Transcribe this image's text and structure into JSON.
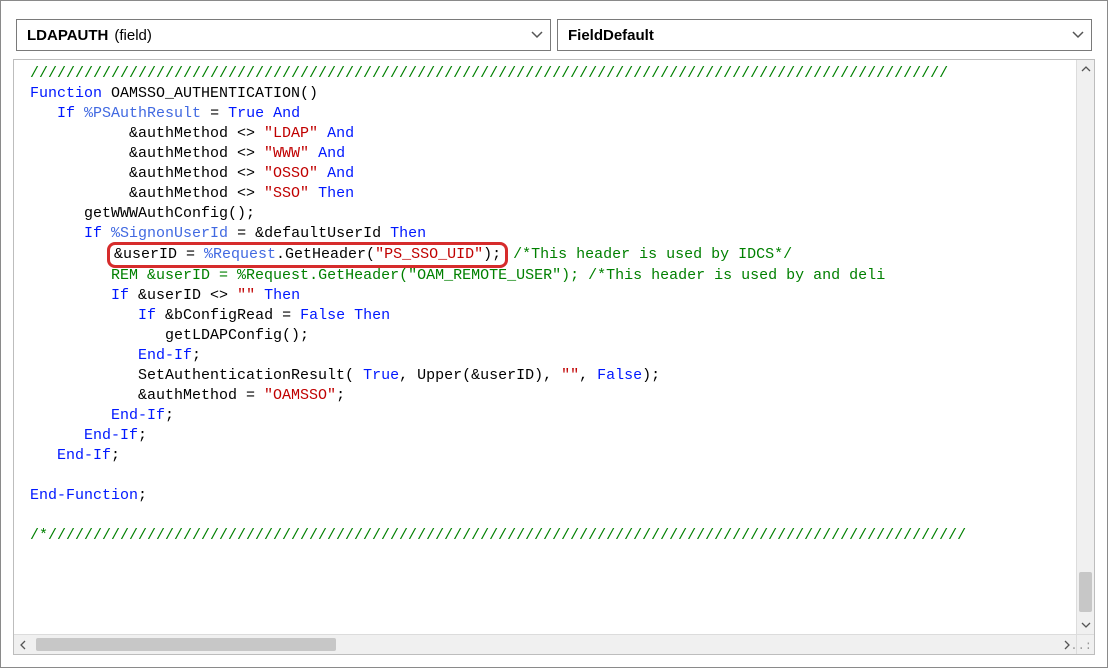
{
  "dropdowns": {
    "object_name": "LDAPAUTH",
    "object_type_noun": "(field)",
    "event": "FieldDefault"
  },
  "code": {
    "slashes_top": "//////////////////////////////////////////////////////////////////////////////////////////////////////",
    "fn_kw": "Function",
    "fn_name": " OAMSSO_AUTHENTICATION()",
    "if1_kw": "If",
    "psauth": " %PSAuthResult",
    "eq": " = ",
    "true1": "True",
    "and1": " And",
    "auth_ldap_pre": "           &authMethod <> ",
    "ldap": "\"LDAP\"",
    "and2": " And",
    "auth_www_pre": "           &authMethod <> ",
    "www": "\"WWW\"",
    "and3": " And",
    "auth_osso_pre": "           &authMethod <> ",
    "osso": "\"OSSO\"",
    "and4": " And",
    "auth_sso_pre": "           &authMethod <> ",
    "sso": "\"SSO\"",
    "then1": " Then",
    "getwww": "      getWWWAuthConfig();",
    "if2_kw": "If",
    "signon_pre": " %SignonUserId",
    "eq2": " = &defaultUserId ",
    "then2": "Then",
    "hl_pre": "&userID = ",
    "hl_req": "%Request",
    "hl_geth": ".GetHeader(",
    "hl_hdr": "\"PS_SSO_UID\"",
    "hl_close": ");",
    "idcs_cmt": " /*This header is used by IDCS*/",
    "rem_line1": "REM &userID = ",
    "rem_req": "%Request",
    "rem_geth": ".GetHeader(",
    "rem_hdr": "\"OAM_REMOTE_USER\"",
    "rem_close": "); ",
    "rem_cmt2": "/*This header is used by and deli",
    "if3_kw": "If",
    "if3_mid": " &userID <> ",
    "empty": "\"\"",
    "then3": " Then",
    "if4_kw": "If",
    "if4_mid": " &bConfigRead = ",
    "false1": "False",
    "then4": " Then",
    "getldap": "               getLDAPConfig();",
    "endif4": "End-If",
    "semi": ";",
    "setauth_pre": "            SetAuthenticationResult( ",
    "true2": "True",
    "setauth_mid": ", Upper(&userID), ",
    "empty2": "\"\"",
    "setauth_mid2": ", ",
    "false2": "False",
    "setauth_close": ");",
    "authm_pre": "            &authMethod = ",
    "oamsso": "\"OAMSSO\"",
    "authm_close": ";",
    "endif3": "End-If",
    "endif2": "End-If",
    "endif1": "End-If",
    "endfn": "End-Function",
    "slashes_bottom": "/*//////////////////////////////////////////////////////////////////////////////////////////////////////"
  }
}
